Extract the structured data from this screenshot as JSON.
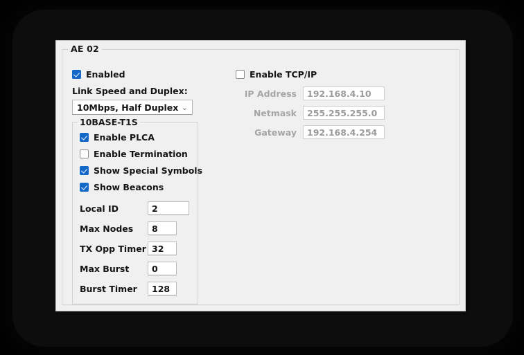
{
  "panel": {
    "group_title": "AE 02"
  },
  "left": {
    "enabled": {
      "label": "Enabled",
      "checked": true
    },
    "link_speed": {
      "label": "Link Speed and Duplex:",
      "value": "10Mbps, Half Duplex",
      "chevron": "⌄"
    },
    "t1s": {
      "title": "10BASE-T1S",
      "checkboxes": [
        {
          "label": "Enable PLCA",
          "checked": true
        },
        {
          "label": "Enable Termination",
          "checked": false
        },
        {
          "label": "Show Special Symbols",
          "checked": true
        },
        {
          "label": "Show Beacons",
          "checked": true
        }
      ],
      "fields": [
        {
          "label": "Local ID",
          "value": "2"
        },
        {
          "label": "Max Nodes",
          "value": "8"
        },
        {
          "label": "TX Opp Timer",
          "value": "32"
        },
        {
          "label": "Max Burst",
          "value": "0"
        },
        {
          "label": "Burst Timer",
          "value": "128"
        }
      ]
    }
  },
  "right": {
    "enable_tcpip": {
      "label": "Enable TCP/IP",
      "checked": false
    },
    "fields": [
      {
        "label": "IP Address",
        "value": "192.168.4.10"
      },
      {
        "label": "Netmask",
        "value": "255.255.255.0"
      },
      {
        "label": "Gateway",
        "value": "192.168.4.254"
      }
    ]
  },
  "colors": {
    "accent": "#1668c8",
    "panel_bg": "#f0f0f0",
    "disabled_text": "#9b9b9b"
  }
}
